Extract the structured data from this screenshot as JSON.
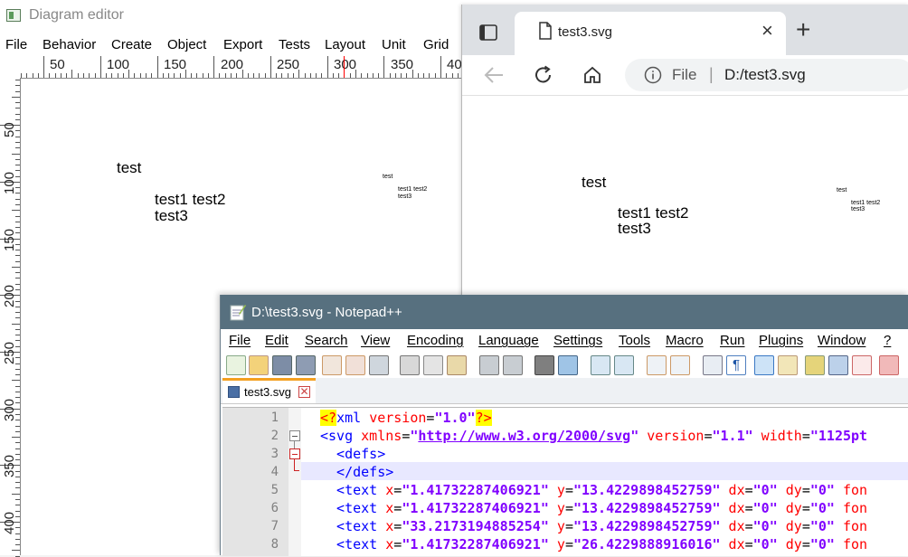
{
  "diagram_editor": {
    "title": "Diagram editor",
    "menu": [
      "File",
      "Behavior",
      "Create",
      "Object",
      "Export",
      "Tests",
      "Layout",
      "Unit",
      "Grid"
    ],
    "ruler_top_labels": [
      "50",
      "100",
      "150",
      "200",
      "250",
      "300",
      "350",
      "40"
    ],
    "ruler_left_labels": [
      "50",
      "100",
      "150",
      "200",
      "250",
      "300",
      "350",
      "400"
    ],
    "canvas": {
      "large_test": "test",
      "large_line1": "test1 test2",
      "large_line2": "test3",
      "small_test": "test",
      "small_line1": "test1 test2",
      "small_line2": "test3"
    }
  },
  "browser": {
    "tab_title": "test3.svg",
    "close_glyph": "×",
    "new_tab_glyph": "+",
    "url_label": "File",
    "url_separator": "|",
    "url": "D:/test3.svg",
    "content": {
      "large_test": "test",
      "large_line1": "test1 test2",
      "large_line2": "test3",
      "small_test": "test",
      "small_line1": "test1 test2",
      "small_line2": "test3"
    }
  },
  "notepad": {
    "title": "D:\\test3.svg - Notepad++",
    "menu": [
      "File",
      "Edit",
      "Search",
      "View",
      "Encoding",
      "Language",
      "Settings",
      "Tools",
      "Macro",
      "Run",
      "Plugins",
      "Window",
      "?"
    ],
    "tab_label": "test3.svg",
    "lines": [
      {
        "num": "1",
        "segments": [
          {
            "t": "pi",
            "s": "<?"
          },
          {
            "t": "tag",
            "s": "xml "
          },
          {
            "t": "attr",
            "s": "version"
          },
          {
            "t": "plain",
            "s": "="
          },
          {
            "t": "val",
            "s": "\"1.0\""
          },
          {
            "t": "pi",
            "s": "?>"
          }
        ]
      },
      {
        "num": "2",
        "segments": [
          {
            "t": "tag",
            "s": "<svg "
          },
          {
            "t": "attr",
            "s": "xmlns"
          },
          {
            "t": "plain",
            "s": "="
          },
          {
            "t": "val",
            "s": "\""
          },
          {
            "t": "url",
            "s": "http://www.w3.org/2000/svg"
          },
          {
            "t": "val",
            "s": "\""
          },
          {
            "t": "attr",
            "s": " version"
          },
          {
            "t": "plain",
            "s": "="
          },
          {
            "t": "val",
            "s": "\"1.1\""
          },
          {
            "t": "attr",
            "s": " width"
          },
          {
            "t": "plain",
            "s": "="
          },
          {
            "t": "val",
            "s": "\"1125pt"
          }
        ]
      },
      {
        "num": "3",
        "segments": [
          {
            "t": "tag",
            "s": "  <defs>"
          }
        ]
      },
      {
        "num": "4",
        "segments": [
          {
            "t": "tag",
            "s": "  </defs>"
          }
        ]
      },
      {
        "num": "5",
        "segments": [
          {
            "t": "tag",
            "s": "  <text "
          },
          {
            "t": "attr",
            "s": "x"
          },
          {
            "t": "plain",
            "s": "="
          },
          {
            "t": "val",
            "s": "\"1.41732287406921\""
          },
          {
            "t": "attr",
            "s": " y"
          },
          {
            "t": "plain",
            "s": "="
          },
          {
            "t": "val",
            "s": "\"13.4229898452759\""
          },
          {
            "t": "attr",
            "s": " dx"
          },
          {
            "t": "plain",
            "s": "="
          },
          {
            "t": "val",
            "s": "\"0\""
          },
          {
            "t": "attr",
            "s": " dy"
          },
          {
            "t": "plain",
            "s": "="
          },
          {
            "t": "val",
            "s": "\"0\""
          },
          {
            "t": "attr",
            "s": " fon"
          }
        ]
      },
      {
        "num": "6",
        "segments": [
          {
            "t": "tag",
            "s": "  <text "
          },
          {
            "t": "attr",
            "s": "x"
          },
          {
            "t": "plain",
            "s": "="
          },
          {
            "t": "val",
            "s": "\"1.41732287406921\""
          },
          {
            "t": "attr",
            "s": " y"
          },
          {
            "t": "plain",
            "s": "="
          },
          {
            "t": "val",
            "s": "\"13.4229898452759\""
          },
          {
            "t": "attr",
            "s": " dx"
          },
          {
            "t": "plain",
            "s": "="
          },
          {
            "t": "val",
            "s": "\"0\""
          },
          {
            "t": "attr",
            "s": " dy"
          },
          {
            "t": "plain",
            "s": "="
          },
          {
            "t": "val",
            "s": "\"0\""
          },
          {
            "t": "attr",
            "s": " fon"
          }
        ]
      },
      {
        "num": "7",
        "segments": [
          {
            "t": "tag",
            "s": "  <text "
          },
          {
            "t": "attr",
            "s": "x"
          },
          {
            "t": "plain",
            "s": "="
          },
          {
            "t": "val",
            "s": "\"33.2173194885254\""
          },
          {
            "t": "attr",
            "s": " y"
          },
          {
            "t": "plain",
            "s": "="
          },
          {
            "t": "val",
            "s": "\"13.4229898452759\""
          },
          {
            "t": "attr",
            "s": " dx"
          },
          {
            "t": "plain",
            "s": "="
          },
          {
            "t": "val",
            "s": "\"0\""
          },
          {
            "t": "attr",
            "s": " dy"
          },
          {
            "t": "plain",
            "s": "="
          },
          {
            "t": "val",
            "s": "\"0\""
          },
          {
            "t": "attr",
            "s": " fon"
          }
        ]
      },
      {
        "num": "8",
        "segments": [
          {
            "t": "tag",
            "s": "  <text "
          },
          {
            "t": "attr",
            "s": "x"
          },
          {
            "t": "plain",
            "s": "="
          },
          {
            "t": "val",
            "s": "\"1.41732287406921\""
          },
          {
            "t": "attr",
            "s": " y"
          },
          {
            "t": "plain",
            "s": "="
          },
          {
            "t": "val",
            "s": "\"26.4229888916016\""
          },
          {
            "t": "attr",
            "s": " dx"
          },
          {
            "t": "plain",
            "s": "="
          },
          {
            "t": "val",
            "s": "\"0\""
          },
          {
            "t": "attr",
            "s": " dy"
          },
          {
            "t": "plain",
            "s": "="
          },
          {
            "t": "val",
            "s": "\"0\""
          },
          {
            "t": "attr",
            "s": " fon"
          }
        ]
      }
    ]
  },
  "colors": {
    "notepad_titlebar": "#57707f",
    "browser_tabstrip": "#dde0e4",
    "xml_tag": "#0000ff",
    "xml_attr": "#ff0000",
    "xml_value": "#8000ff",
    "ruler_marker": "#ff0000",
    "active_line": "#e8e8ff"
  }
}
